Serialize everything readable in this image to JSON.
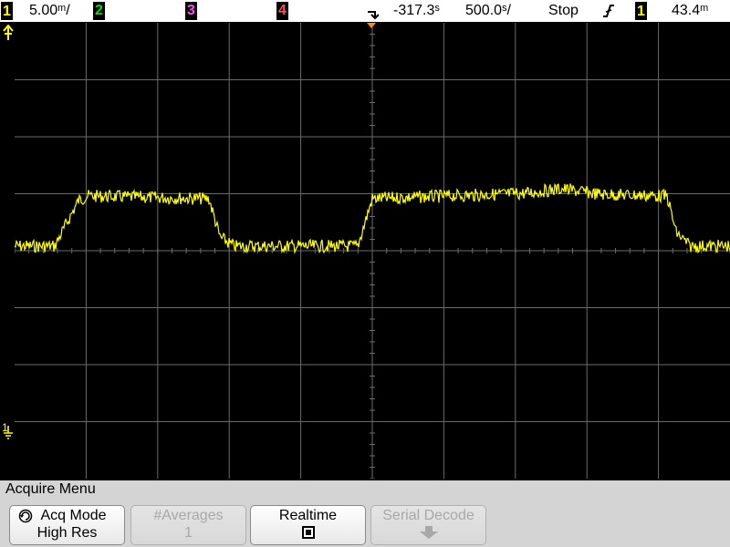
{
  "status_bar": {
    "ch1_label": "1",
    "ch1_scale": "5.00ᵐ/",
    "ch2_label": "2",
    "ch3_label": "3",
    "ch4_label": "4",
    "trigger_delay": "-317.3ˢ",
    "timebase": "500.0ˢ/",
    "run_state": "Stop",
    "trigger_slope_icon": "rising-edge-icon",
    "trigger_source": "1",
    "trigger_level": "43.4ᵐ"
  },
  "markers": {
    "trigger_level_marker": "T",
    "ground_marker": "1"
  },
  "colors": {
    "channel1": "#ffff00",
    "grid": "#6b6b6b",
    "background": "#000000",
    "trigger_pos": "#ff8c00"
  },
  "menu": {
    "title": "Acquire Menu",
    "softkeys": [
      {
        "label": "Acq Mode",
        "value": "High Res",
        "enabled": true,
        "icon": "rotate-knob-icon"
      },
      {
        "label": "#Averages",
        "value": "1",
        "enabled": false
      },
      {
        "label": "Realtime",
        "value": "",
        "enabled": true,
        "icon": "checkbox-checked-icon"
      },
      {
        "label": "Serial Decode",
        "value": "",
        "enabled": false,
        "icon": "arrow-down-icon"
      }
    ]
  }
}
